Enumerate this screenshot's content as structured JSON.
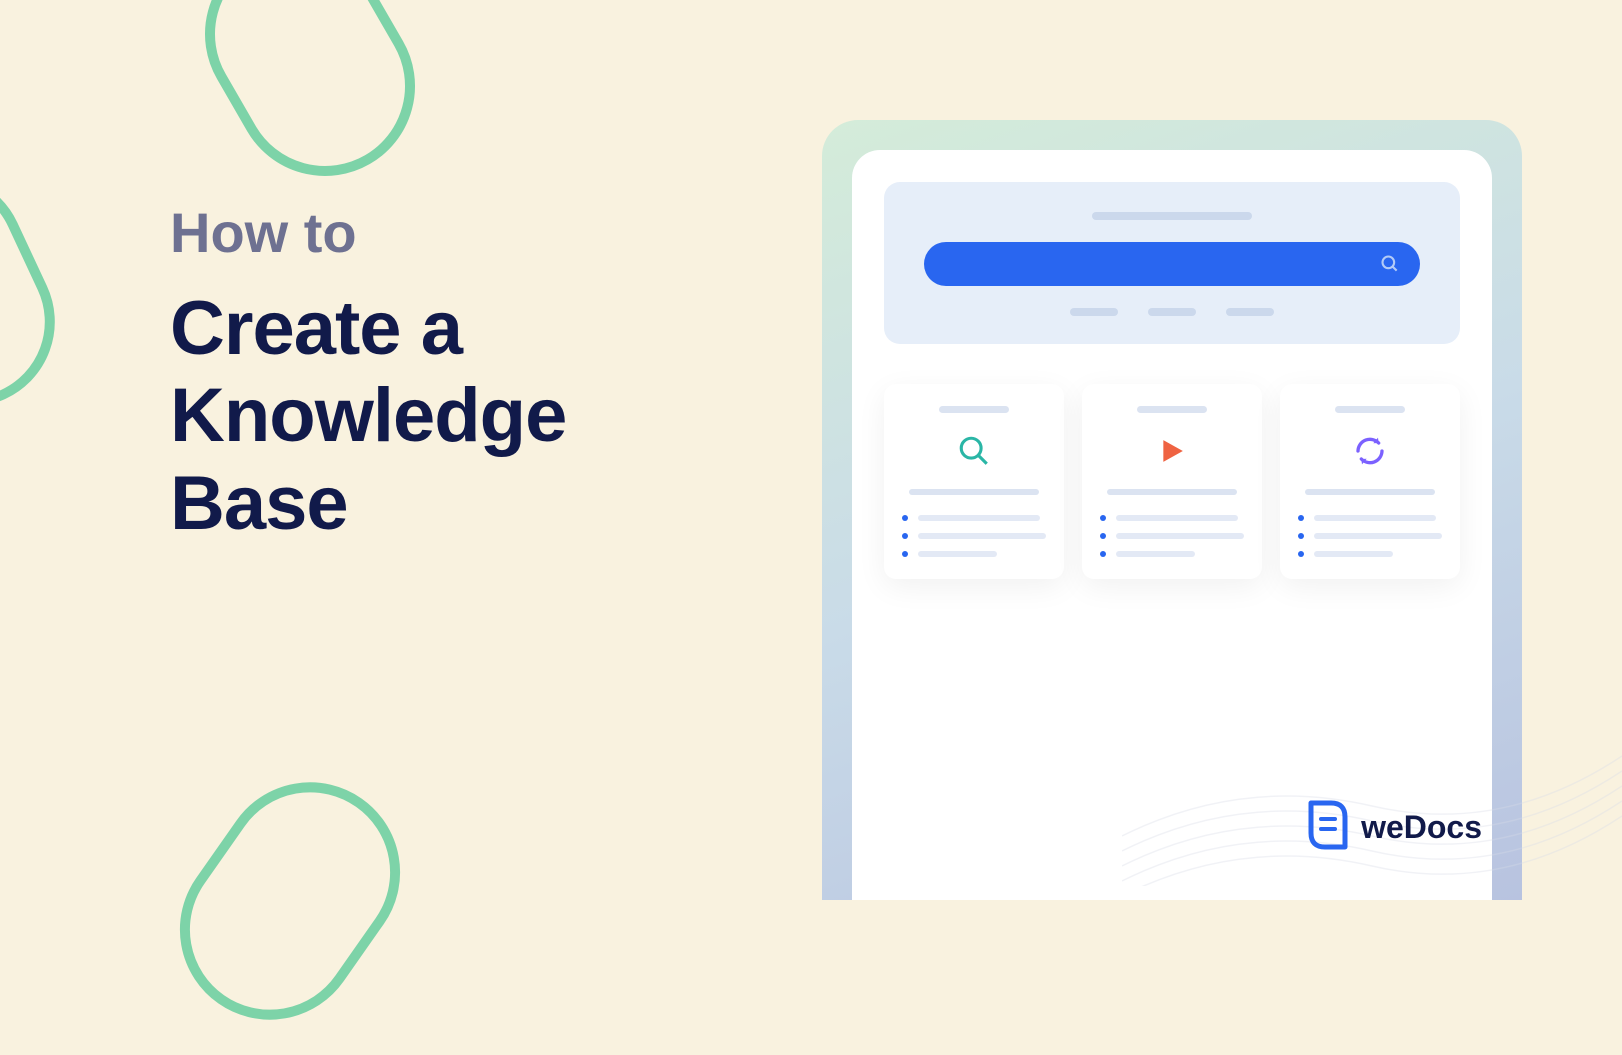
{
  "heading": {
    "sub": "How to",
    "main": "Create a\nKnowledge\nBase"
  },
  "mockup": {
    "cards": [
      {
        "icon": "search-icon"
      },
      {
        "icon": "play-icon"
      },
      {
        "icon": "refresh-icon"
      }
    ]
  },
  "logo": {
    "prefix": "we",
    "suffix": "Docs"
  },
  "colors": {
    "background": "#f9f2df",
    "accent_green": "#7dd3a8",
    "text_muted": "#6e7191",
    "text_dark": "#111a4a",
    "blue": "#2966f0",
    "orange": "#ef6342",
    "purple": "#7b61ff",
    "teal": "#2ab6a6"
  }
}
